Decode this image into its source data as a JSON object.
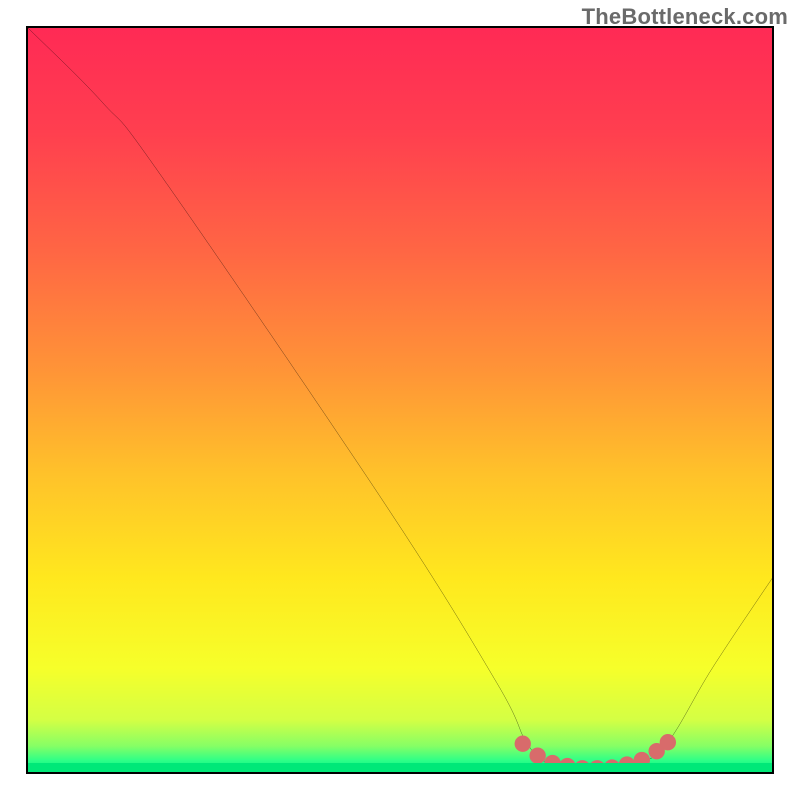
{
  "watermark": "TheBottleneck.com",
  "chart_data": {
    "type": "line",
    "title": "",
    "xlabel": "",
    "ylabel": "",
    "xlim": [
      0,
      100
    ],
    "ylim": [
      0,
      100
    ],
    "curve_points": [
      {
        "x": 0,
        "y": 100
      },
      {
        "x": 10,
        "y": 90
      },
      {
        "x": 18,
        "y": 80
      },
      {
        "x": 48,
        "y": 36
      },
      {
        "x": 63,
        "y": 12
      },
      {
        "x": 67,
        "y": 4
      },
      {
        "x": 70,
        "y": 1.2
      },
      {
        "x": 76,
        "y": 0.5
      },
      {
        "x": 82,
        "y": 1.2
      },
      {
        "x": 86,
        "y": 4
      },
      {
        "x": 92,
        "y": 14
      },
      {
        "x": 100,
        "y": 26
      }
    ],
    "marker_points": [
      {
        "x": 66.5,
        "y": 3.8
      },
      {
        "x": 68.5,
        "y": 2.2
      },
      {
        "x": 70.5,
        "y": 1.2
      },
      {
        "x": 72.5,
        "y": 0.8
      },
      {
        "x": 74.5,
        "y": 0.5
      },
      {
        "x": 76.5,
        "y": 0.5
      },
      {
        "x": 78.5,
        "y": 0.6
      },
      {
        "x": 80.5,
        "y": 1.0
      },
      {
        "x": 82.5,
        "y": 1.6
      },
      {
        "x": 84.5,
        "y": 2.8
      },
      {
        "x": 86.0,
        "y": 4.0
      }
    ],
    "gradient_stops": [
      {
        "offset": 0.0,
        "color": "#ff2a55"
      },
      {
        "offset": 0.14,
        "color": "#ff3f4f"
      },
      {
        "offset": 0.3,
        "color": "#ff6644"
      },
      {
        "offset": 0.46,
        "color": "#ff9437"
      },
      {
        "offset": 0.6,
        "color": "#ffc22a"
      },
      {
        "offset": 0.74,
        "color": "#ffe81e"
      },
      {
        "offset": 0.86,
        "color": "#f6ff2a"
      },
      {
        "offset": 0.93,
        "color": "#d4ff44"
      },
      {
        "offset": 0.965,
        "color": "#86ff65"
      },
      {
        "offset": 0.985,
        "color": "#2cff88"
      },
      {
        "offset": 1.0,
        "color": "#00e878"
      }
    ],
    "marker_color": "#d86b6b",
    "curve_color": "#000000",
    "green_baseline_height_pct": 1.2
  }
}
